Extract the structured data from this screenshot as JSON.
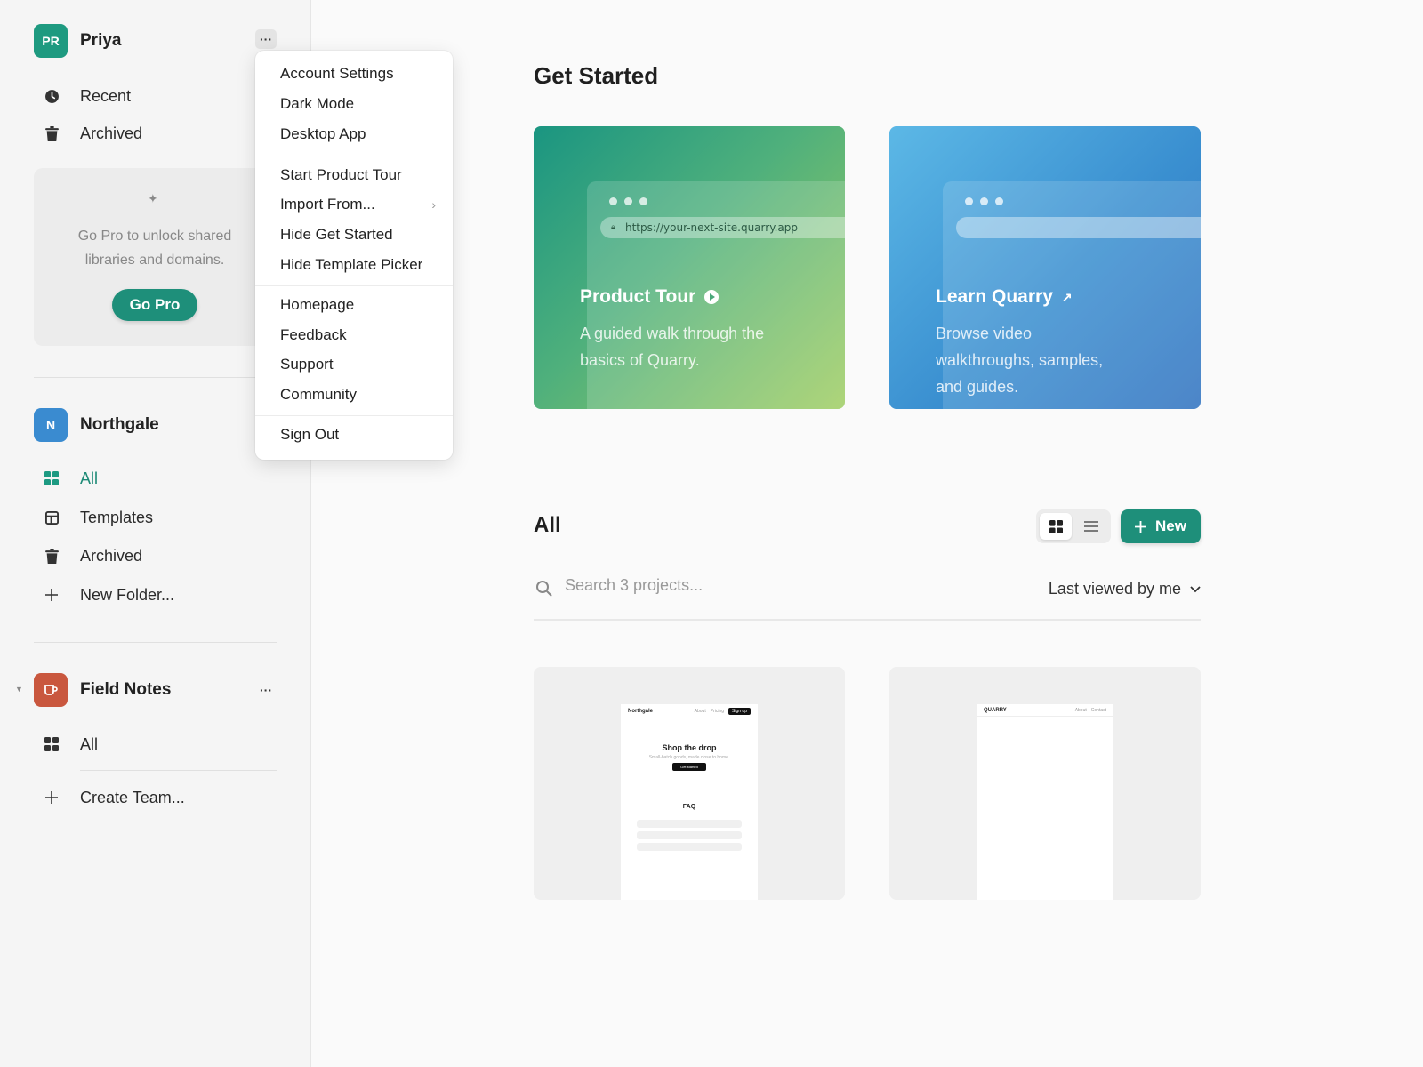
{
  "account": {
    "initials": "PR",
    "name": "Priya",
    "avatar_color": "#1e9a80"
  },
  "sidebar": {
    "nav": [
      {
        "label": "Recent",
        "icon": "clock-icon"
      },
      {
        "label": "Archived",
        "icon": "trash-icon"
      }
    ],
    "pro_box": {
      "text": "Go Pro to unlock shared libraries and domains.",
      "button": "Go Pro"
    },
    "teams": [
      {
        "initials": "N",
        "name": "Northgale",
        "avatar_color": "#3a8bd0",
        "items": [
          {
            "label": "All",
            "icon": "grid-icon",
            "active": true
          },
          {
            "label": "Templates",
            "icon": "template-icon"
          },
          {
            "label": "Archived",
            "icon": "trash-icon"
          },
          {
            "label": "New Folder...",
            "icon": "plus-icon"
          }
        ]
      },
      {
        "name": "Field Notes",
        "avatar_color": "#c9573e",
        "icon": "cup-icon",
        "items": [
          {
            "label": "All",
            "icon": "grid-icon"
          }
        ]
      }
    ],
    "create_team": "Create Team..."
  },
  "menu": {
    "groups": [
      [
        "Account Settings",
        "Dark Mode",
        "Desktop App"
      ],
      [
        "Start Product Tour",
        "Import From...",
        "Hide Get Started",
        "Hide Template Picker"
      ],
      [
        "Homepage",
        "Feedback",
        "Support",
        "Community"
      ],
      [
        "Sign Out"
      ]
    ]
  },
  "main": {
    "get_started_title": "Get Started",
    "cards": [
      {
        "title": "Product Tour",
        "desc": "A guided walk through the basics of Quarry.",
        "url": "https://your-next-site.quarry.app"
      },
      {
        "title": "Learn Quarry",
        "desc": "Browse video walkthroughs, samples, and guides."
      }
    ],
    "section_title": "All",
    "new_button": "New",
    "search_placeholder": "Search 3 projects...",
    "sort_label": "Last viewed by me",
    "projects": [
      {
        "brand": "Northgale",
        "links": [
          "About",
          "Pricing"
        ],
        "cta": "Sign up",
        "hero": "Shop the drop",
        "sub": "Small-batch goods, made close to home.",
        "button": "Get started",
        "faq": "FAQ"
      },
      {
        "brand": "QUARRY",
        "links": [
          "About",
          "Contact"
        ]
      }
    ]
  },
  "colors": {
    "accent": "#1e8f7a"
  }
}
